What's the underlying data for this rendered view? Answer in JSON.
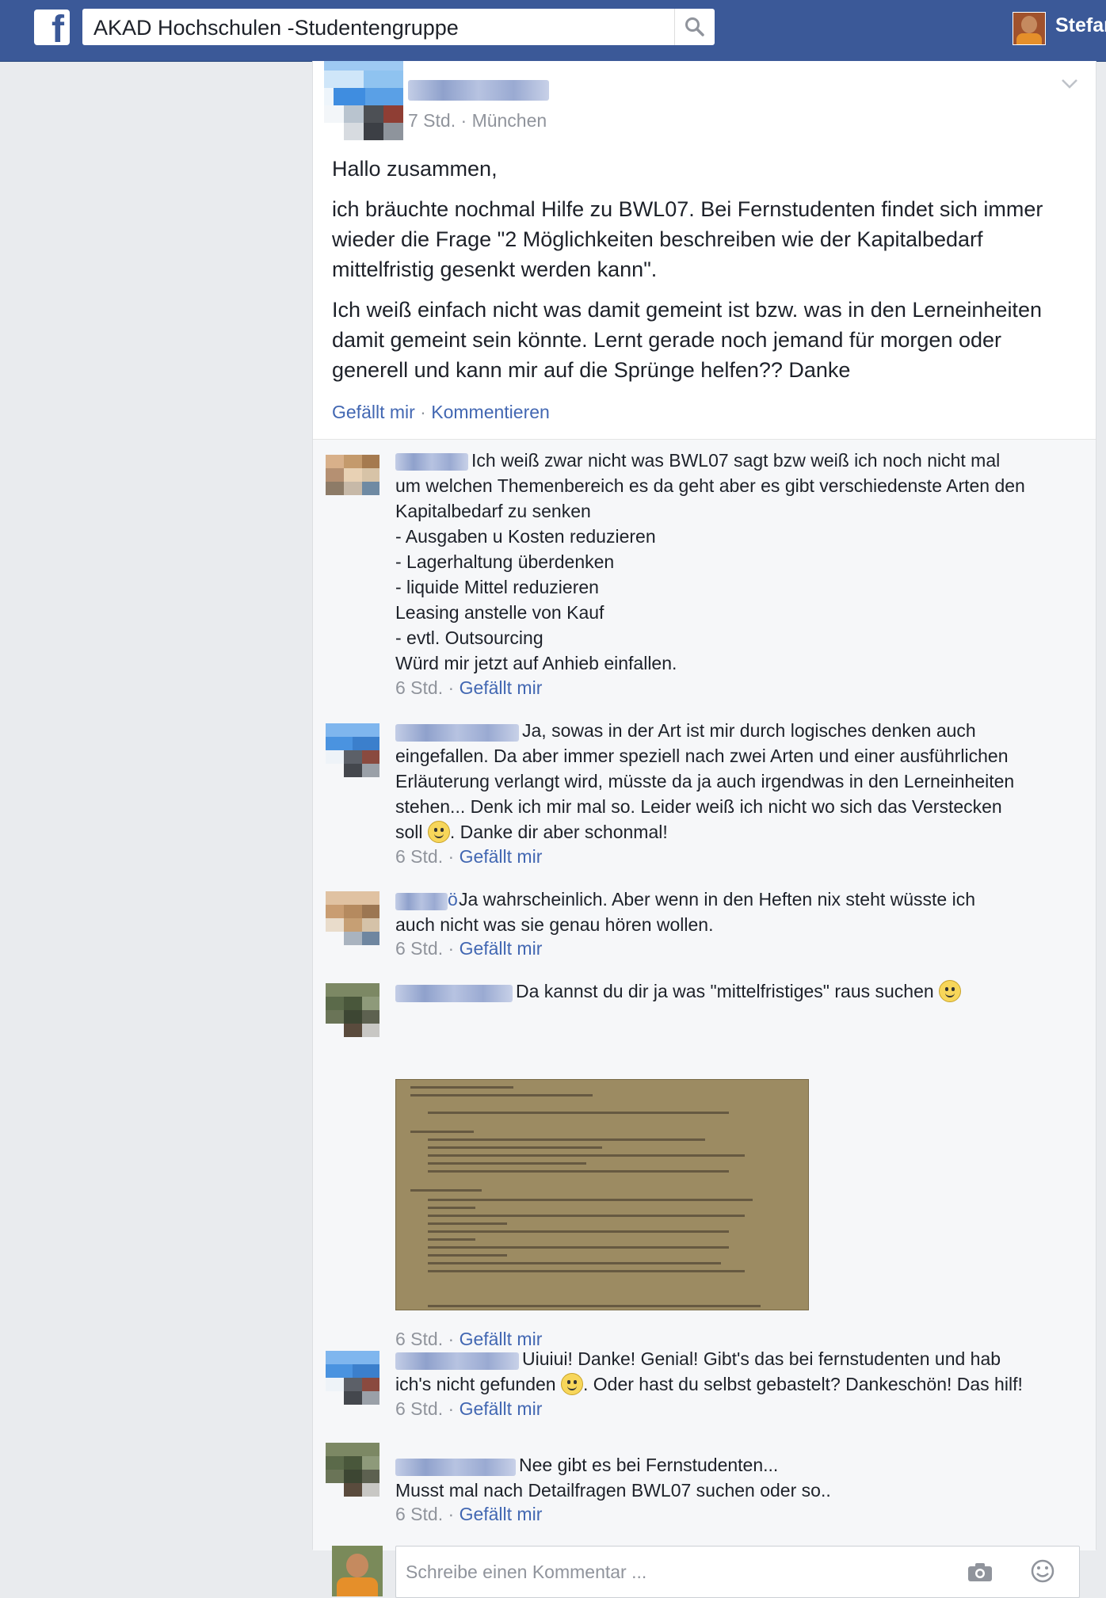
{
  "topbar": {
    "logo": "f",
    "search_value": "AKAD Hochschulen -Studentengruppe",
    "user_name": "Stefan"
  },
  "post": {
    "time": "7 Std.",
    "location": "München",
    "meta_sep": " · ",
    "greeting": "Hallo zusammen,",
    "paragraph1": "ich bräuchte nochmal Hilfe zu BWL07. Bei Fernstudenten findet sich immer wieder die Frage \"2 Möglichkeiten beschreiben wie der Kapitalbedarf mittelfristig gesenkt werden kann\".",
    "paragraph2": "Ich weiß einfach nicht was damit gemeint ist bzw. was in den Lerneinheiten damit gemeint sein könnte. Lernt gerade noch jemand für morgen oder generell und kann mir auf die Sprünge helfen?? Danke",
    "like_label": "Gefällt mir",
    "comment_label": "Kommentieren"
  },
  "comments": [
    {
      "lines": [
        "Ich weiß zwar nicht was BWL07 sagt bzw weiß ich noch nicht mal",
        "um welchen Themenbereich es da geht aber es gibt verschiedenste Arten den",
        "Kapitalbedarf zu senken",
        "- Ausgaben u Kosten reduzieren",
        "- Lagerhaltung überdenken",
        "- liquide Mittel reduzieren",
        "Leasing anstelle von Kauf",
        "- evtl. Outsourcing",
        "Würd mir jetzt auf Anhieb einfallen."
      ],
      "time": "6 Std.",
      "like": "Gefällt mir"
    },
    {
      "lines": [
        "Ja, sowas in der Art ist mir durch logisches denken auch",
        "eingefallen. Da aber immer speziell nach zwei Arten und einer ausführlichen",
        "Erläuterung verlangt wird, müsste da ja auch irgendwas in den Lerneinheiten",
        "stehen... Denk ich mir mal so. Leider weiß ich nicht wo sich das Verstecken"
      ],
      "line_last_pre": "soll",
      "line_last_post": ". Danke dir aber schonmal!",
      "time": "6 Std.",
      "like": "Gefällt mir"
    },
    {
      "name_tail": "ö",
      "lines": [
        "Ja wahrscheinlich. Aber wenn in den Heften nix steht wüsste ich",
        "auch nicht was sie genau hören wollen."
      ],
      "time": "6 Std.",
      "like": "Gefällt mir"
    },
    {
      "text": "Da kannst du dir ja was \"mittelfristiges\" raus suchen",
      "time": "6 Std.",
      "like": "Gefällt mir"
    },
    {
      "line1": "Uiuiui! Danke! Genial! Gibt's das bei fernstudenten und hab",
      "line2_pre": "ich's nicht gefunden",
      "line2_post": ". Oder hast du selbst gebastelt? Dankeschön! Das hilf!",
      "time": "6 Std.",
      "like": "Gefällt mir"
    },
    {
      "lines": [
        "Nee gibt es bei Fernstudenten...",
        "Musst mal nach Detailfragen BWL07 suchen oder so.."
      ],
      "time": "6 Std.",
      "like": "Gefällt mir"
    }
  ],
  "reply": {
    "placeholder": "Schreibe einen Kommentar ..."
  }
}
